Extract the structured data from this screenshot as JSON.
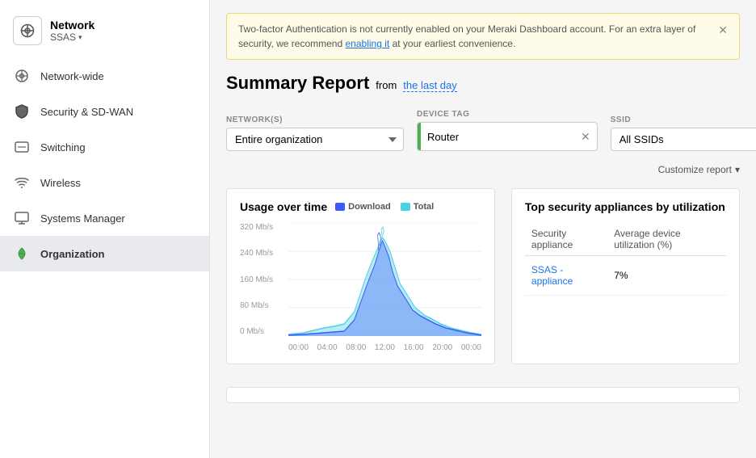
{
  "sidebar": {
    "network_label": "Network",
    "network_sub": "SSAS",
    "items": [
      {
        "id": "network-wide",
        "label": "Network-wide",
        "icon": "⚙"
      },
      {
        "id": "security-sdwan",
        "label": "Security & SD-WAN",
        "icon": "🛡"
      },
      {
        "id": "switching",
        "label": "Switching",
        "icon": "⬜"
      },
      {
        "id": "wireless",
        "label": "Wireless",
        "icon": "📶"
      },
      {
        "id": "systems-manager",
        "label": "Systems Manager",
        "icon": "💻"
      },
      {
        "id": "organization",
        "label": "Organization",
        "icon": "🌿",
        "active": true
      }
    ]
  },
  "banner": {
    "text": "Two-factor Authentication is not currently enabled on your Meraki Dashboard account. For an extra layer of security, we recommend ",
    "link_text": "enabling it",
    "text_end": " at your earliest convenience."
  },
  "page": {
    "title": "Summary Report",
    "from_label": "from",
    "date_link": "the last day"
  },
  "filters": {
    "networks_label": "NETWORK(S)",
    "networks_value": "Entire organization",
    "device_tag_label": "DEVICE TAG",
    "device_tag_value": "Router",
    "ssid_label": "SSID",
    "ssid_value": "All SSIDs",
    "customize_label": "Customize report"
  },
  "usage_chart": {
    "title": "Usage over time",
    "legend": [
      {
        "label": "Download",
        "color": "#3d5afe"
      },
      {
        "label": "Total",
        "color": "#4dd0e1"
      }
    ],
    "y_labels": [
      "320 Mb/s",
      "240 Mb/s",
      "160 Mb/s",
      "80 Mb/s",
      "0 Mb/s"
    ],
    "x_labels": [
      "00:00",
      "04:00",
      "08:00",
      "12:00",
      "16:00",
      "20:00",
      "00:00"
    ]
  },
  "security_table": {
    "title": "Top security appliances by utilization",
    "col1": "Security appliance",
    "col2": "Average device utilization (%)",
    "rows": [
      {
        "name": "SSAS - appliance",
        "value": "7%"
      }
    ]
  }
}
